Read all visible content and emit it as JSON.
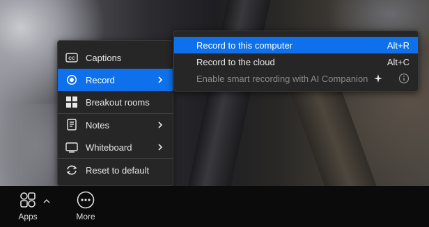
{
  "menu": {
    "items": [
      {
        "label": "Captions",
        "icon": "cc-icon"
      },
      {
        "label": "Record",
        "icon": "record-icon",
        "has_submenu": true,
        "active": true
      },
      {
        "label": "Breakout rooms",
        "icon": "breakout-rooms-icon"
      },
      {
        "label": "Notes",
        "icon": "notes-icon",
        "has_submenu": true
      },
      {
        "label": "Whiteboard",
        "icon": "whiteboard-icon",
        "has_submenu": true
      },
      {
        "label": "Reset to default",
        "icon": "reset-icon"
      }
    ]
  },
  "submenu": {
    "items": [
      {
        "label": "Record to this computer",
        "shortcut": "Alt+R",
        "active": true
      },
      {
        "label": "Record to the cloud",
        "shortcut": "Alt+C"
      },
      {
        "label": "Enable smart recording with AI Companion",
        "disabled": true,
        "icon": "sparkle-icon",
        "trailing_icon": "info-icon"
      }
    ]
  },
  "toolbar": {
    "apps_label": "Apps",
    "more_label": "More"
  },
  "colors": {
    "accent": "#0e71eb",
    "menu_bg": "#262626",
    "toolbar_bg": "#0b0b0b"
  }
}
